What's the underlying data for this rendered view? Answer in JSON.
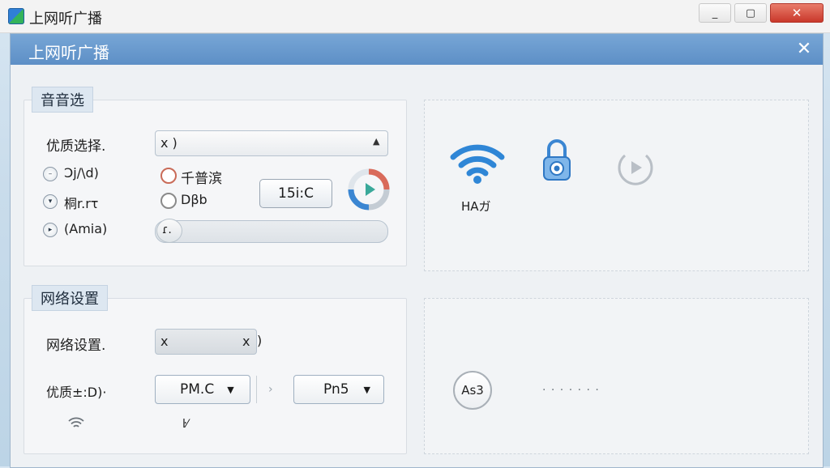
{
  "window": {
    "title": "上网听广播",
    "minimize": "_",
    "maximize": "▢",
    "close": "✕"
  },
  "dialog": {
    "title": "上网听广播",
    "close": "✕"
  },
  "audio_group": {
    "tab": "音音选",
    "quality_label": "优质选择.",
    "quality_value": "x )",
    "options": [
      {
        "glyph": "–",
        "label": "Ͻj/\\d)"
      },
      {
        "glyph": "▾",
        "label": "桐r.rτ"
      },
      {
        "glyph": "▸",
        "label": "(Amia)"
      }
    ],
    "radios": [
      {
        "label": "千普滨"
      },
      {
        "label": "Dβb"
      }
    ],
    "time_button": "15i:C",
    "slider_value": "ɾ."
  },
  "top_right": {
    "wifi_caption": "HAガ"
  },
  "network_group": {
    "tab": "网络设置",
    "setting_label": "网络设置.",
    "setting_value_left": "x",
    "setting_value_right": "x",
    "quality_label": "优质±:D)·",
    "dropdown1": "PM.C",
    "dropdown2": "Pn5",
    "small_label": "ŀ⁄"
  },
  "bottom_right": {
    "badge": "As3",
    "dots": "· · · · · · ·"
  },
  "colors": {
    "accent": "#5d8fc6",
    "wifi_blue": "#2f86d6",
    "ring_red": "#d96b5b"
  }
}
